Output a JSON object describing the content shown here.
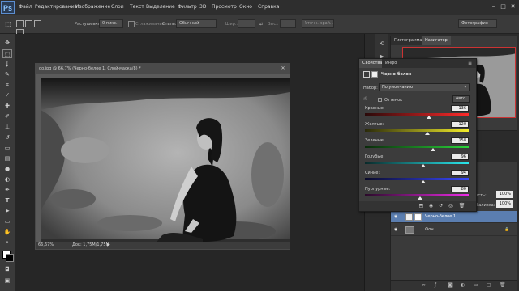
{
  "app": {
    "logo": "Ps",
    "menu": [
      "Файл",
      "Редактирование",
      "Изображение",
      "Слои",
      "Текст",
      "Выделение",
      "Фильтр",
      "3D",
      "Просмотр",
      "Окно",
      "Справка"
    ],
    "window_controls": [
      "–",
      "□",
      "✕"
    ]
  },
  "options_bar": {
    "feather_label": "Растушевка:",
    "feather_value": "0 пикс.",
    "smooth_label": "Сглаживание",
    "style_label": "Стиль:",
    "style_value": "Обычный",
    "width_label": "Шир.:",
    "height_label": "Выс.:",
    "refine_button": "Уточн. край...",
    "workspace_value": "Фотография"
  },
  "document": {
    "tab_title": "do.jpg @ 66,7% (Черно-белое 1, Слой-маска/8) *",
    "zoom": "66,67%",
    "doc_info": "Док: 1,75M/1,75M"
  },
  "navigator": {
    "tabs": [
      "Гистограмма",
      "Навигатор"
    ]
  },
  "properties": {
    "tabs": [
      "Свойства",
      "Инфо"
    ],
    "adjustment_title": "Черно-белое",
    "preset_label": "Набор:",
    "preset_value": "По умолчанию",
    "tint_label": "Оттенок",
    "auto_button": "Авто",
    "sliders": [
      {
        "label": "Красные:",
        "value": "136",
        "fraction": 0.62,
        "gradient": [
          "#2a0a0a",
          "#ff2a2a"
        ]
      },
      {
        "label": "Желтые:",
        "value": "120",
        "fraction": 0.6,
        "gradient": [
          "#2a2a0a",
          "#f4ee2a"
        ]
      },
      {
        "label": "Зеленые:",
        "value": "158",
        "fraction": 0.66,
        "gradient": [
          "#0a2a0a",
          "#2ad43a"
        ]
      },
      {
        "label": "Голубые:",
        "value": "96",
        "fraction": 0.56,
        "gradient": [
          "#0a2a2a",
          "#2ae8ee"
        ]
      },
      {
        "label": "Синие:",
        "value": "94",
        "fraction": 0.56,
        "gradient": [
          "#0a0a2a",
          "#3a4aff"
        ]
      },
      {
        "label": "Пурпурные:",
        "value": "80",
        "fraction": 0.53,
        "gradient": [
          "#2a0a2a",
          "#ee2ae8"
        ]
      }
    ]
  },
  "layers_panel": {
    "opacity_label": "ачность:",
    "opacity_value": "100%",
    "fill_label": "Заливка:",
    "fill_value": "100%",
    "layers": [
      {
        "name": "Черно-белое 1"
      },
      {
        "name": "Фон"
      }
    ]
  },
  "colors": {
    "accent": "#5c8ed1",
    "selection": "#c33"
  }
}
